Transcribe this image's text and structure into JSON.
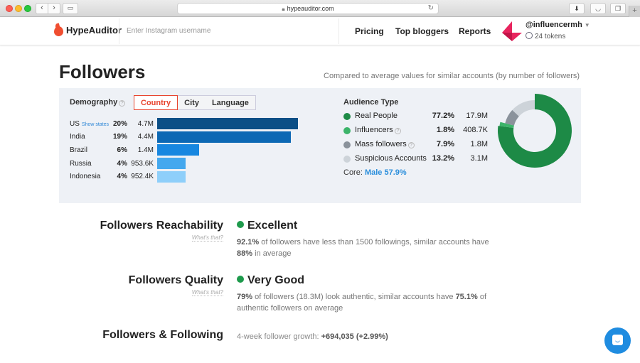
{
  "browser": {
    "url": "hypeauditor.com",
    "icons": [
      "lock-icon",
      "reload-icon",
      "download-icon",
      "pocket-icon",
      "tabs-icon",
      "new-tab-icon"
    ]
  },
  "header": {
    "brand": "HypeAuditor",
    "search_placeholder": "Enter Instagram username",
    "nav": [
      "Pricing",
      "Top bloggers",
      "Reports"
    ],
    "username": "@influencermh",
    "tokens": "24 tokens"
  },
  "page": {
    "title": "Followers",
    "compare_note": "Compared to average values for similar accounts (by number of followers)"
  },
  "demography": {
    "label": "Demography",
    "tabs": [
      "Country",
      "City",
      "Language"
    ],
    "active_tab": "Country",
    "show_states": "Show states",
    "countries": [
      {
        "name": "US",
        "pct": "20%",
        "value": "4.7M",
        "share": 20,
        "color": "#0b4f86"
      },
      {
        "name": "India",
        "pct": "19%",
        "value": "4.4M",
        "share": 19,
        "color": "#0c68b4"
      },
      {
        "name": "Brazil",
        "pct": "6%",
        "value": "1.4M",
        "share": 6,
        "color": "#1787e0"
      },
      {
        "name": "Russia",
        "pct": "4%",
        "value": "953.6K",
        "share": 4,
        "color": "#44a8ee"
      },
      {
        "name": "Indonesia",
        "pct": "4%",
        "value": "952.4K",
        "share": 4,
        "color": "#8ecffa"
      }
    ]
  },
  "audience": {
    "title": "Audience Type",
    "types": [
      {
        "label": "Real People",
        "pct": "77.2%",
        "value": "17.9M",
        "share": 77.2,
        "color": "#1d8a46",
        "help": false
      },
      {
        "label": "Influencers",
        "pct": "1.8%",
        "value": "408.7K",
        "share": 1.8,
        "color": "#3cb46a",
        "help": true
      },
      {
        "label": "Mass followers",
        "pct": "7.9%",
        "value": "1.8M",
        "share": 7.9,
        "color": "#8a929b",
        "help": true
      },
      {
        "label": "Suspicious Accounts",
        "pct": "13.2%",
        "value": "3.1M",
        "share": 13.2,
        "color": "#cdd3d9",
        "help": false
      }
    ],
    "core_label": "Core:",
    "core_value": "Male 57.9%"
  },
  "metrics": {
    "whats_that": "What's that?",
    "reachability": {
      "title": "Followers Reachability",
      "status": "Excellent",
      "desc_bold1": "92.1%",
      "desc_mid": " of followers have less than 1500 followings, similar accounts have ",
      "desc_bold2": "88%",
      "desc_end": " in average"
    },
    "quality": {
      "title": "Followers Quality",
      "status": "Very Good",
      "desc_bold1": "79%",
      "desc_mid": " of followers (18.3M) look authentic, similar accounts have ",
      "desc_bold2": "75.1%",
      "desc_end": " of authentic followers on average"
    },
    "following": {
      "title": "Followers & Following",
      "growth_label": "4-week follower growth: ",
      "growth_value": "+694,035 (+2.99%)"
    }
  }
}
